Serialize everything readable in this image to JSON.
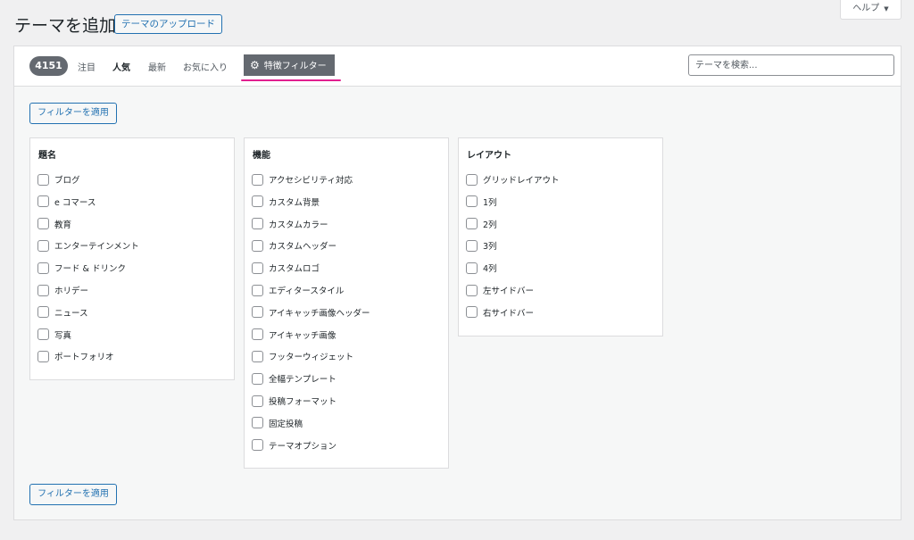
{
  "header": {
    "title": "テーマを追加",
    "upload_label": "テーマのアップロード",
    "help_label": "ヘルプ",
    "help_caret": "▼"
  },
  "filterbar": {
    "count": "4151",
    "nav": [
      "注目",
      "人気",
      "最新",
      "お気に入り"
    ],
    "feature_label": "特徴フィルター",
    "search_placeholder": "テーマを検索..."
  },
  "apply_label": "フィルターを適用",
  "groups": {
    "subject": {
      "title": "題名",
      "options": [
        "ブログ",
        "e コマース",
        "教育",
        "エンターテインメント",
        "フード & ドリンク",
        "ホリデー",
        "ニュース",
        "写真",
        "ポートフォリオ"
      ]
    },
    "features": {
      "title": "機能",
      "options": [
        "アクセシビリティ対応",
        "カスタム背景",
        "カスタムカラー",
        "カスタムヘッダー",
        "カスタムロゴ",
        "エディタースタイル",
        "アイキャッチ画像ヘッダー",
        "アイキャッチ画像",
        "フッターウィジェット",
        "全幅テンプレート",
        "投稿フォーマット",
        "固定投稿",
        "テーマオプション"
      ]
    },
    "layout": {
      "title": "レイアウト",
      "options": [
        "グリッドレイアウト",
        "1列",
        "2列",
        "3列",
        "4列",
        "左サイドバー",
        "右サイドバー"
      ]
    }
  },
  "icons": {
    "feature": "gear-icon",
    "help": "caret-down-icon"
  },
  "colors": {
    "accent": "#2271b1",
    "badge": "#646970",
    "highlight": "#e11f8f"
  }
}
